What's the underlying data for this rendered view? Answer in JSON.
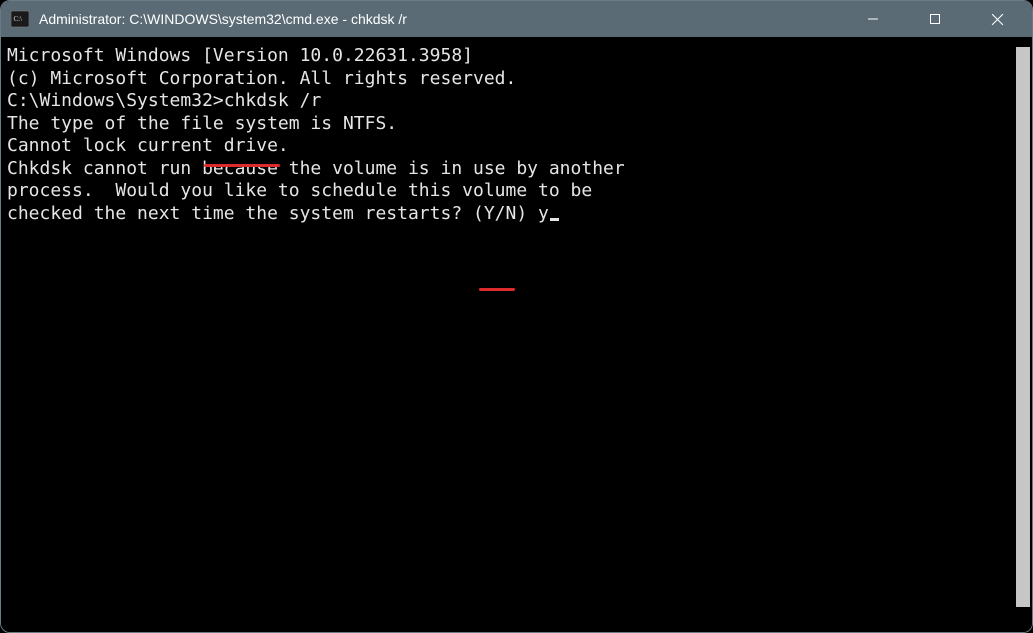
{
  "window": {
    "title": "Administrator: C:\\WINDOWS\\system32\\cmd.exe - chkdsk  /r"
  },
  "terminal": {
    "line1": "Microsoft Windows [Version 10.0.22631.3958]",
    "line2": "(c) Microsoft Corporation. All rights reserved.",
    "blank1": "",
    "line3a": "C:\\Windows\\System32>",
    "line3b": "chkdsk /r",
    "line4": "The type of the file system is NTFS.",
    "line5": "Cannot lock current drive.",
    "blank2": "",
    "line6": "Chkdsk cannot run because the volume is in use by another",
    "line7": "process.  Would you like to schedule this volume to be",
    "line8a": "checked the next time the system restarts? (Y/N) ",
    "line8b": "y"
  }
}
